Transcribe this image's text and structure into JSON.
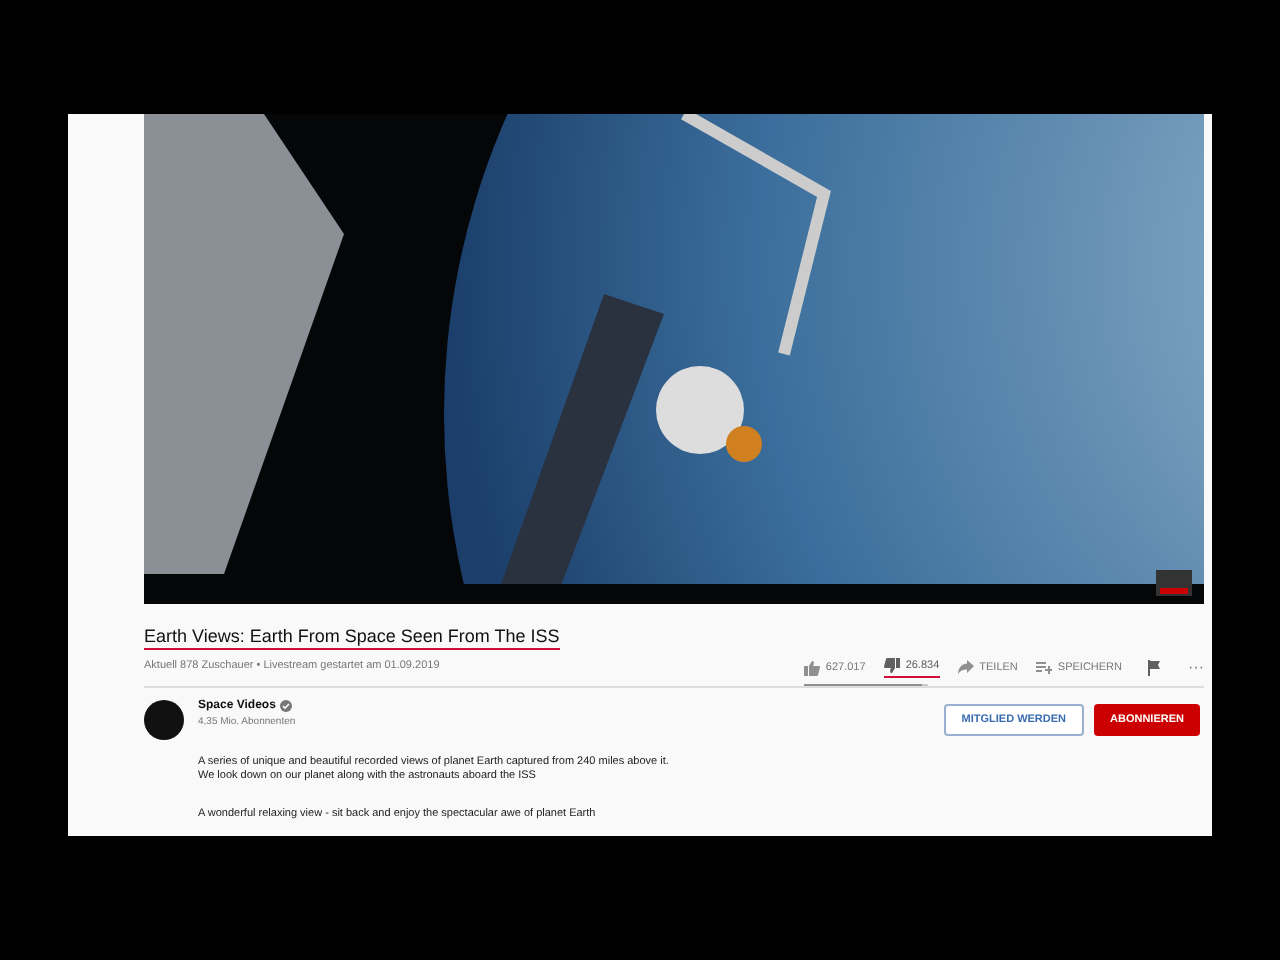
{
  "video": {
    "title": "Earth Views: Earth From Space Seen From The ISS",
    "title_underlined": true,
    "meta": "Aktuell 878 Zuschauer • Livestream gestartet am 01.09.2019"
  },
  "actions": [
    {
      "kind": "like",
      "label": "627.017",
      "underlined": false
    },
    {
      "kind": "dislike",
      "label": "26.834",
      "underlined": true
    },
    {
      "kind": "share",
      "label": "TEILEN"
    },
    {
      "kind": "save",
      "label": "SPEICHERN"
    },
    {
      "kind": "flag"
    },
    {
      "kind": "more",
      "label": "···"
    }
  ],
  "rating_bar": {
    "level": 0.96
  },
  "channel": {
    "name": "Space Videos",
    "verified": true,
    "subscribers": "4,35 Mio. Abonnenten"
  },
  "buttons": [
    {
      "kind": "join",
      "label": "MITGLIED WERDEN"
    },
    {
      "kind": "subscribe",
      "label": "ABONNIEREN"
    }
  ],
  "description": [
    [
      "A series of unique and beautiful recorded views of planet Earth captured from 240 miles above it.",
      "We look down on our planet along with the astronauts aboard the ISS"
    ],
    [
      "A wonderful relaxing view - sit back and enjoy the spectacular awe of planet Earth"
    ]
  ]
}
